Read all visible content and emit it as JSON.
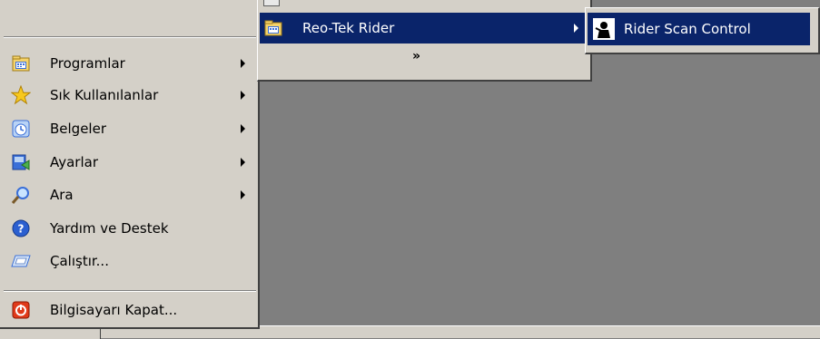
{
  "start_menu": {
    "items": [
      {
        "label": "Programlar",
        "icon": "programs-folder-icon",
        "has_submenu": true
      },
      {
        "label": "Sık Kullanılanlar",
        "icon": "star-icon",
        "has_submenu": true
      },
      {
        "label": "Belgeler",
        "icon": "documents-icon",
        "has_submenu": true
      },
      {
        "label": "Ayarlar",
        "icon": "settings-icon",
        "has_submenu": true
      },
      {
        "label": "Ara",
        "icon": "magnifier-icon",
        "has_submenu": true
      },
      {
        "label": "Yardım ve Destek",
        "icon": "help-icon",
        "has_submenu": false
      },
      {
        "label": "Çalıştır...",
        "icon": "run-icon",
        "has_submenu": false
      },
      {
        "label": "Bilgisayarı Kapat...",
        "icon": "shutdown-icon",
        "has_submenu": false
      }
    ]
  },
  "programs_submenu": {
    "item_label": "Reo-Tek Rider",
    "expand_glyph": "»"
  },
  "rider_submenu": {
    "item_label": "Rider Scan Control"
  },
  "colors": {
    "menu_bg": "#d4d0c8",
    "highlight": "#0a246a",
    "desktop": "#7f7f7f"
  }
}
